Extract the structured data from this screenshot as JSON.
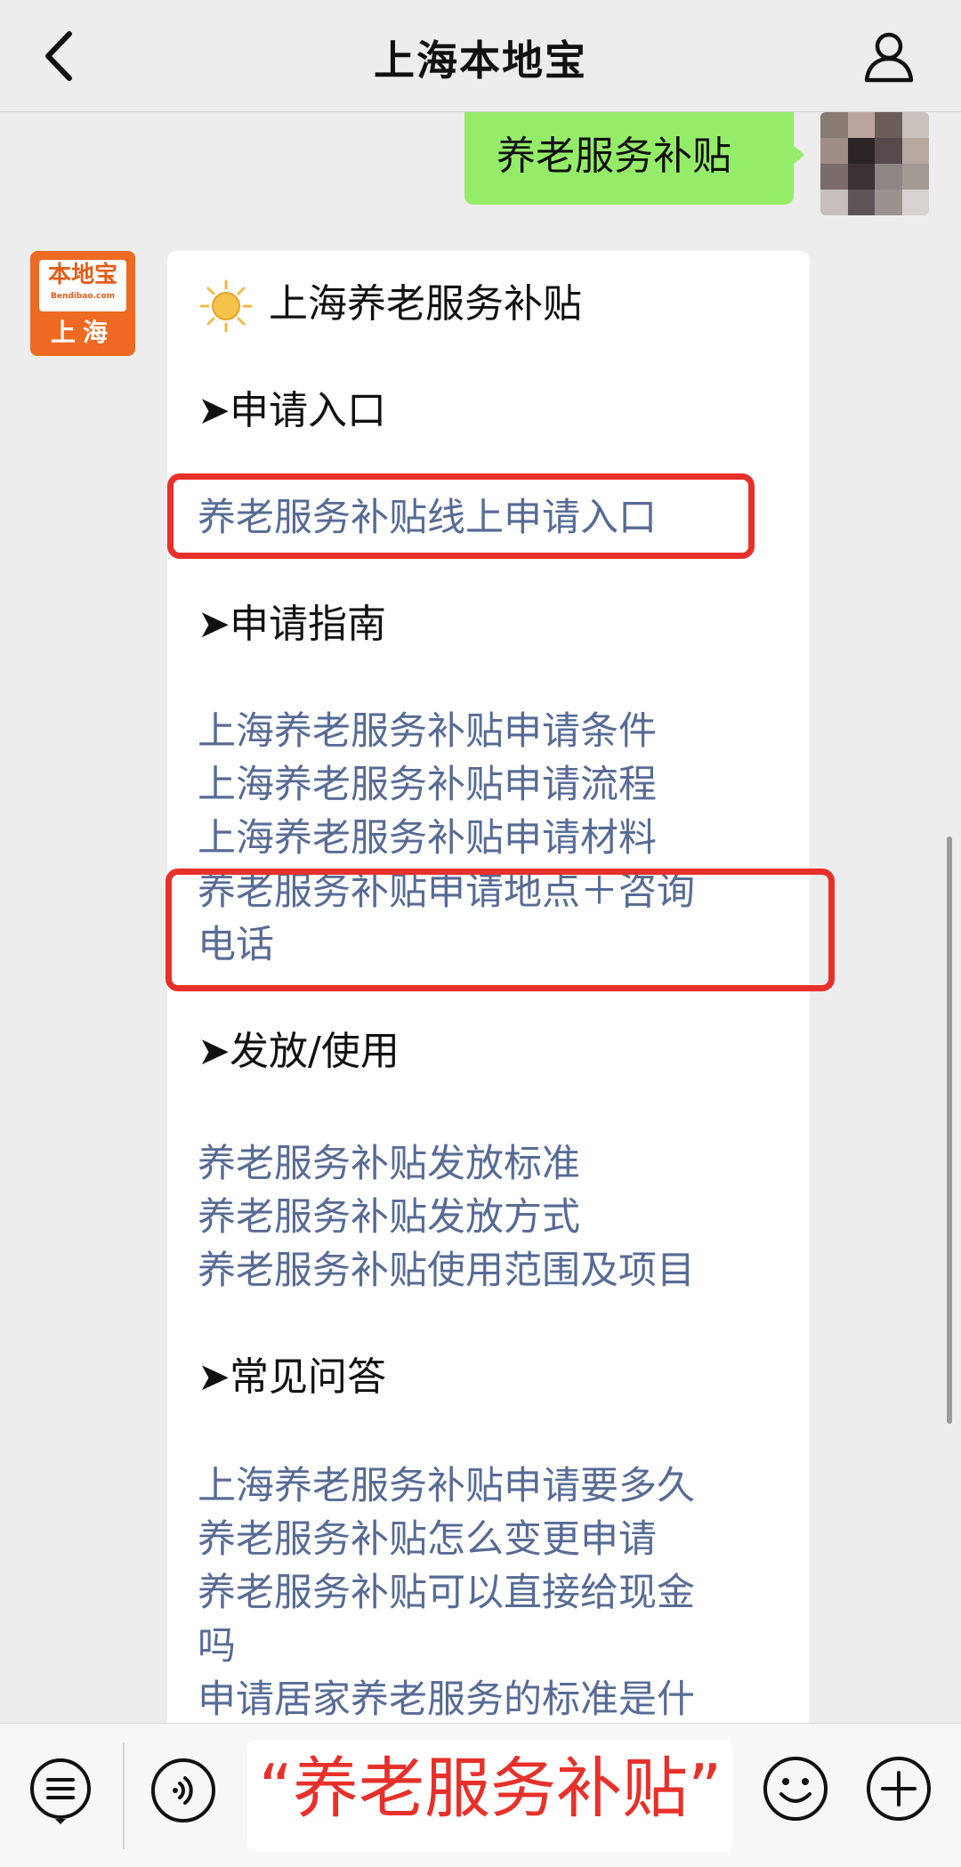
{
  "header": {
    "title": "上海本地宝"
  },
  "chat": {
    "sent_message": "养老服务补贴",
    "bot_avatar": {
      "name": "本地宝",
      "url": "Bendibao.com",
      "city": "上海"
    },
    "reply": {
      "title": "上海养老服务补贴",
      "sections": [
        {
          "heading": "申请入口",
          "links": [
            "养老服务补贴线上申请入口"
          ]
        },
        {
          "heading": "申请指南",
          "links": [
            "上海养老服务补贴申请条件",
            "上海养老服务补贴申请流程",
            "上海养老服务补贴申请材料",
            "养老服务补贴申请地点＋咨询",
            "电话"
          ]
        },
        {
          "heading": "发放/使用",
          "links": [
            "养老服务补贴发放标准",
            "养老服务补贴发放方式",
            "养老服务补贴使用范围及项目"
          ]
        },
        {
          "heading": "常见问答",
          "links": [
            "上海养老服务补贴申请要多久",
            "养老服务补贴怎么变更申请",
            "养老服务补贴可以直接给现金",
            "吗",
            "申请居家养老服务的标准是什"
          ]
        }
      ]
    }
  },
  "footer": {
    "keyword_open_quote": "“",
    "keyword": "养老服务补贴",
    "keyword_close_quote": "”"
  },
  "colors": {
    "background": "#ededed",
    "sent_bubble": "#95ec69",
    "link": "#576b95",
    "highlight": "#e8302a",
    "brand": "#ee6a22"
  },
  "icons": [
    "back-arrow-icon",
    "profile-icon",
    "sun-icon",
    "menu-icon",
    "voice-icon",
    "emoji-icon",
    "plus-icon"
  ]
}
